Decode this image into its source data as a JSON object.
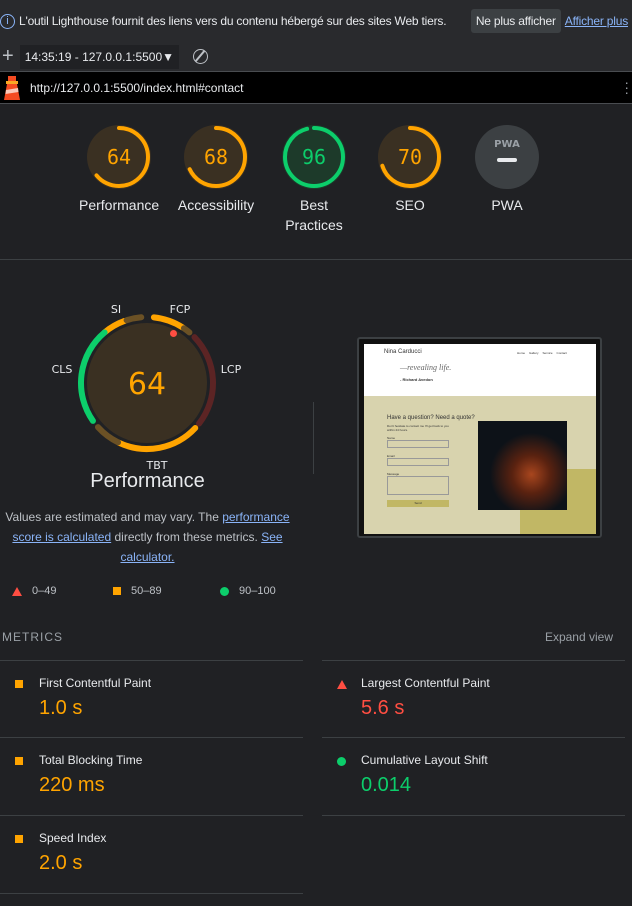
{
  "infobar": {
    "message": "L'outil Lighthouse fournit des liens vers du contenu hébergé sur des sites Web tiers.",
    "dismiss": "Ne plus afficher",
    "more": "Afficher plus"
  },
  "toolbar": {
    "report": "14:35:19 - 127.0.0.1:5500"
  },
  "urlbar": {
    "url": "http://127.0.0.1:5500/index.html#contact"
  },
  "colors": {
    "pass": "#0cce6b",
    "average": "#ffa400",
    "fail": "#ff4e42",
    "background": "#202124"
  },
  "scores": [
    {
      "label": "Performance",
      "value": "64",
      "level": "average",
      "fill": 0.64
    },
    {
      "label": "Accessibility",
      "value": "68",
      "level": "average",
      "fill": 0.68
    },
    {
      "label": "Best Practices",
      "value": "96",
      "level": "pass",
      "fill": 0.96
    },
    {
      "label": "SEO",
      "value": "70",
      "level": "average",
      "fill": 0.7
    },
    {
      "label": "PWA",
      "value": "PWA",
      "level": "na"
    }
  ],
  "perf": {
    "score": "64",
    "title": "Performance",
    "labels": {
      "si": "SI",
      "fcp": "FCP",
      "lcp": "LCP",
      "tbt": "TBT",
      "cls": "CLS"
    },
    "estimate_1": "Values are estimated and may vary. The ",
    "estimate_link1": "performance score is calculated",
    "estimate_2": " directly from these metrics. ",
    "estimate_link2": "See calculator."
  },
  "legend": {
    "fail": "0–49",
    "average": "50–89",
    "pass": "90–100"
  },
  "metrics": {
    "heading": "METRICS",
    "expand": "Expand view",
    "items": [
      {
        "title": "First Contentful Paint",
        "value": "1.0 s",
        "level": "average"
      },
      {
        "title": "Largest Contentful Paint",
        "value": "5.6 s",
        "level": "fail"
      },
      {
        "title": "Total Blocking Time",
        "value": "220 ms",
        "level": "average"
      },
      {
        "title": "Cumulative Layout Shift",
        "value": "0.014",
        "level": "pass"
      },
      {
        "title": "Speed Index",
        "value": "2.0 s",
        "level": "average"
      }
    ]
  },
  "preview": {
    "site": "Nina Carducci",
    "nav": [
      "Home",
      "Gallery",
      "Service",
      "Contact"
    ],
    "quote": "—revealing life.",
    "author": "- Richard Avedon",
    "heading": "Have a question? Need a quote?",
    "sub": "Don't hesitate to contact me I'll get back to you within 24 hours.",
    "name": "Name",
    "email": "Email",
    "message": "Message",
    "send": "Send"
  }
}
